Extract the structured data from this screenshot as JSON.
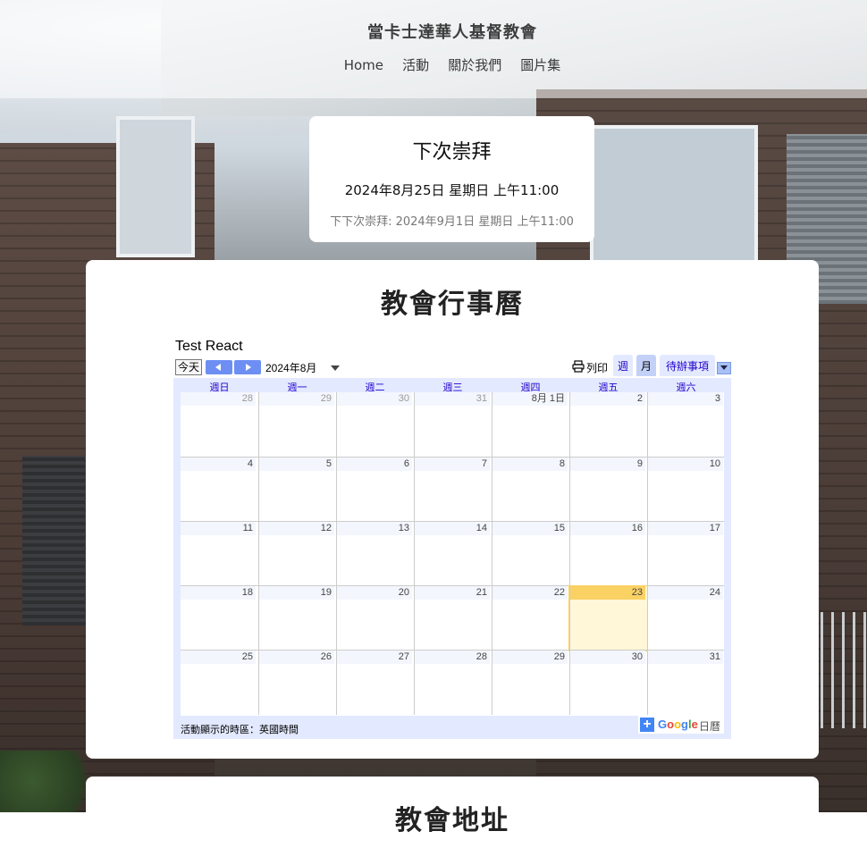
{
  "site": {
    "title": "當卡士達華人基督教會",
    "nav": [
      "Home",
      "活動",
      "關於我們",
      "圖片集"
    ]
  },
  "worship": {
    "heading": "下次崇拜",
    "date": "2024年8月25日 星期日 上午11:00",
    "next": "下下次崇拜: 2024年9月1日 星期日 上午11:00"
  },
  "calendar_section": {
    "heading": "教會行事曆",
    "calendar": {
      "title": "Test React",
      "today_button": "今天",
      "month_label": "2024年8月",
      "print_label": "列印",
      "tabs": {
        "week": "週",
        "month": "月",
        "agenda": "待辦事項"
      },
      "weekdays": [
        "週日",
        "週一",
        "週二",
        "週三",
        "週四",
        "週五",
        "週六"
      ],
      "weeks": [
        [
          "28",
          "29",
          "30",
          "31",
          "8月 1日",
          "2",
          "3"
        ],
        [
          "4",
          "5",
          "6",
          "7",
          "8",
          "9",
          "10"
        ],
        [
          "11",
          "12",
          "13",
          "14",
          "15",
          "16",
          "17"
        ],
        [
          "18",
          "19",
          "20",
          "21",
          "22",
          "23",
          "24"
        ],
        [
          "25",
          "26",
          "27",
          "28",
          "29",
          "30",
          "31"
        ]
      ],
      "today": "23",
      "timezone_note": "活動顯示的時區：英國時間",
      "google_logo": "Google",
      "google_calendar_label": "日曆",
      "colors": {
        "accent": "#6d8ff3",
        "today": "#fad163",
        "grid_bg": "#e3e9ff",
        "link": "#2200cc"
      }
    }
  },
  "address_section": {
    "heading": "教會地址"
  }
}
